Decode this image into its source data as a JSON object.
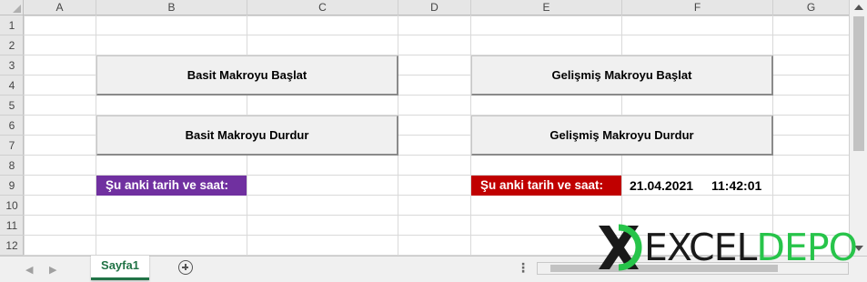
{
  "columns": [
    "A",
    "B",
    "C",
    "D",
    "E",
    "F",
    "G"
  ],
  "rows": [
    "1",
    "2",
    "3",
    "4",
    "5",
    "6",
    "7",
    "8",
    "9",
    "10",
    "11",
    "12"
  ],
  "buttons": {
    "simple_start": "Basit Makroyu Başlat",
    "simple_stop": "Basit Makroyu Durdur",
    "advanced_start": "Gelişmiş Makroyu Başlat",
    "advanced_stop": "Gelişmiş Makroyu Durdur"
  },
  "labels": {
    "left_datetime_label": "Şu anki tarih ve saat:",
    "right_datetime_label": "Şu anki tarih ve saat:",
    "date_value": "21.04.2021",
    "time_value": "11:42:01"
  },
  "sheet": {
    "tab_name": "Sayfa1"
  },
  "logo": {
    "part1": "EXCEL",
    "part2": "DEPO"
  },
  "colors": {
    "purple_label": "#7030a0",
    "red_label": "#c00000",
    "excel_green": "#217346",
    "logo_green": "#27c44a"
  }
}
